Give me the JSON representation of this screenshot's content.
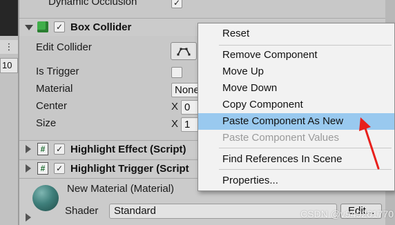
{
  "left_panel": {
    "dots": "⋮",
    "number": "10"
  },
  "top_row": {
    "label": "Dynamic Occlusion",
    "checked": "✓"
  },
  "box_collider": {
    "title": "Box Collider",
    "checked": "✓",
    "edit_collider_label": "Edit Collider",
    "is_trigger_label": "Is Trigger",
    "material_label": "Material",
    "material_value": "None",
    "center_label": "Center",
    "center_x_label": "X",
    "center_x_value": "0",
    "size_label": "Size",
    "size_x_label": "X",
    "size_x_value": "1"
  },
  "highlight_effect": {
    "icon": "#",
    "checked": "✓",
    "title": "Highlight Effect (Script)"
  },
  "highlight_trigger": {
    "icon": "#",
    "checked": "✓",
    "title": "Highlight Trigger (Script"
  },
  "material_section": {
    "title": "New Material (Material)",
    "shader_label": "Shader",
    "shader_value": "Standard",
    "edit_button": "Edit..."
  },
  "context_menu": {
    "items": [
      {
        "label": "Reset",
        "enabled": true
      },
      {
        "label": "Remove Component",
        "enabled": true
      },
      {
        "label": "Move Up",
        "enabled": true
      },
      {
        "label": "Move Down",
        "enabled": true
      },
      {
        "label": "Copy Component",
        "enabled": true
      },
      {
        "label": "Paste Component As New",
        "enabled": true,
        "highlighted": true
      },
      {
        "label": "Paste Component Values",
        "enabled": false
      },
      {
        "label": "Find References In Scene",
        "enabled": true
      },
      {
        "label": "Properties...",
        "enabled": true
      }
    ]
  },
  "watermark": "CSDN @v949261770",
  "colors": {
    "highlight": "#99c9ef",
    "annotation_arrow": "#e8201c",
    "panel_bg": "#c8c8c8",
    "menu_bg": "#f2f2f2"
  }
}
